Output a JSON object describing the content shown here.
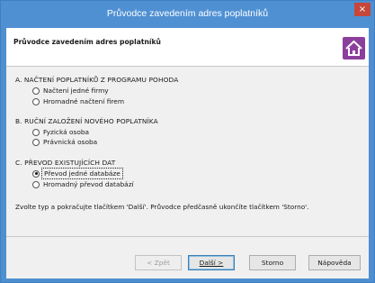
{
  "window": {
    "title": "Průvodce zavedením adres poplatníků",
    "close_glyph": "×"
  },
  "header": {
    "title": "Průvodce zavedením adres poplatníků",
    "icon": "home-icon"
  },
  "sections": [
    {
      "heading": "A. NAČTENÍ POPLATNÍKŮ Z PROGRAMU POHODA",
      "options": [
        {
          "label": "Načtení jedné firmy",
          "checked": false
        },
        {
          "label": "Hromadné načtení firem",
          "checked": false
        }
      ]
    },
    {
      "heading": "B. RUČNÍ ZALOŽENÍ NOVÉHO POPLATNÍKA",
      "options": [
        {
          "label": "Fyzická osoba",
          "checked": false
        },
        {
          "label": "Právnická osoba",
          "checked": false
        }
      ]
    },
    {
      "heading": "C. PŘEVOD EXISTUJÍCÍCH DAT",
      "options": [
        {
          "label": "Převod jedné databáze",
          "checked": true
        },
        {
          "label": "Hromadný převod databází",
          "checked": false
        }
      ]
    }
  ],
  "hint": "Zvolte typ a pokračujte tlačítkem 'Další'. Průvodce předčasně ukončíte tlačítkem 'Storno'.",
  "buttons": {
    "back": "< Zpět",
    "next": "Další >",
    "cancel": "Storno",
    "help": "Nápověda"
  },
  "colors": {
    "titlebar": "#4f90d3",
    "close": "#c7463a",
    "accent_icon": "#8b3e9c"
  }
}
